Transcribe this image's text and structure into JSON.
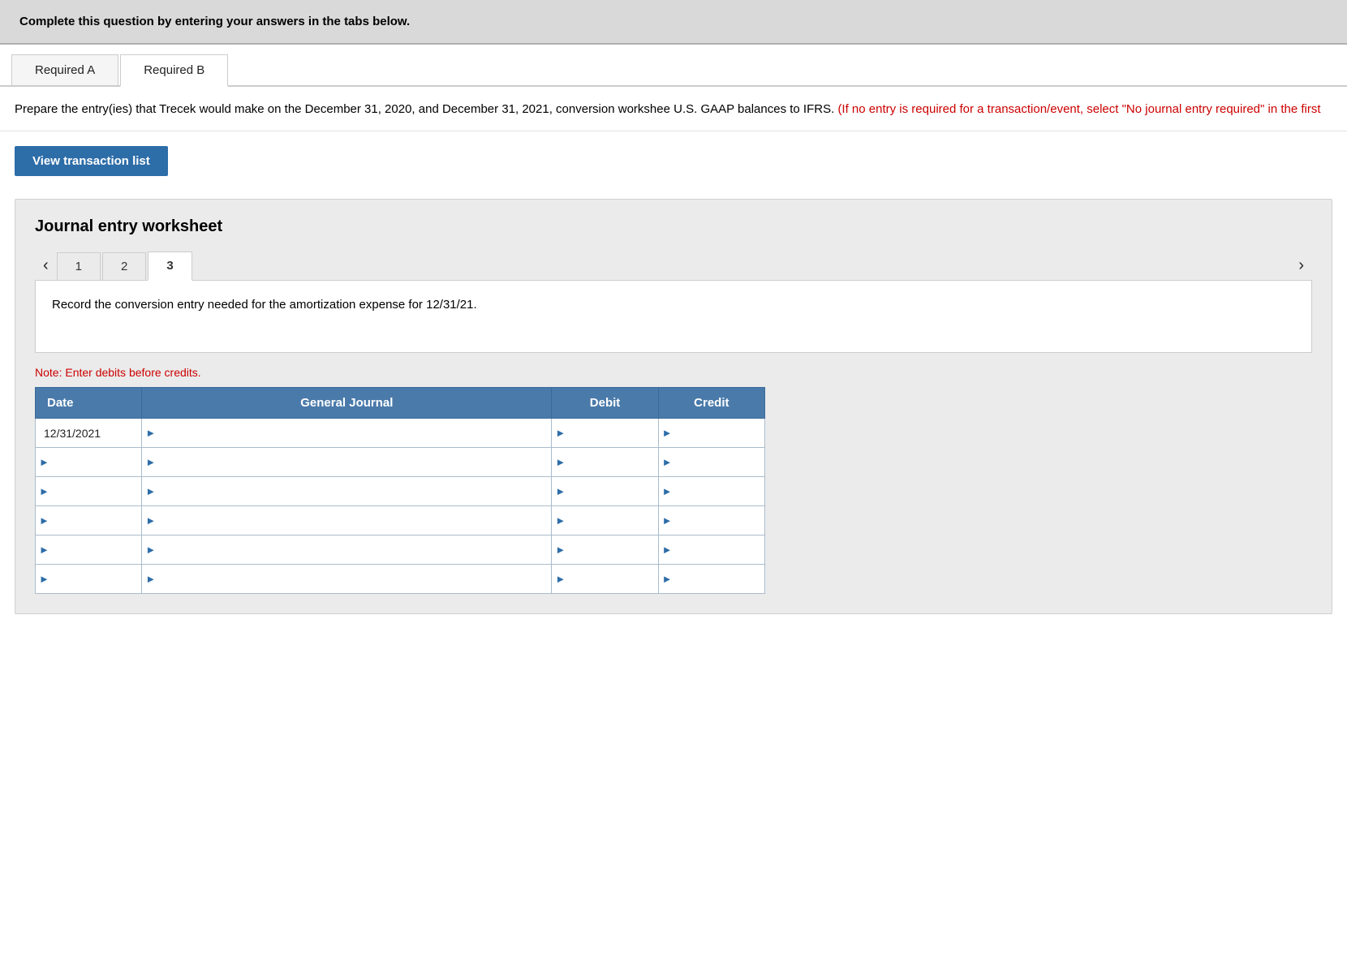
{
  "header": {
    "instruction": "Complete this question by entering your answers in the tabs below."
  },
  "tabs": [
    {
      "label": "Required A",
      "active": false
    },
    {
      "label": "Required B",
      "active": true
    }
  ],
  "instruction_text": {
    "main": "Prepare the entry(ies) that Trecek would make on the December 31, 2020, and December 31, 2021, conversion workshee U.S. GAAP balances to IFRS.",
    "red": "(If no entry is required for a transaction/event, select \"No journal entry required\" in the first"
  },
  "view_transaction_btn": "View transaction list",
  "worksheet": {
    "title": "Journal entry worksheet",
    "entry_tabs": [
      {
        "label": "1",
        "active": false
      },
      {
        "label": "2",
        "active": false
      },
      {
        "label": "3",
        "active": true
      }
    ],
    "description": "Record the conversion entry needed for the amortization expense for 12/31/21.",
    "note": "Note: Enter debits before credits.",
    "table": {
      "headers": [
        "Date",
        "General Journal",
        "Debit",
        "Credit"
      ],
      "rows": [
        {
          "date": "12/31/2021",
          "journal": "",
          "debit": "",
          "credit": ""
        },
        {
          "date": "",
          "journal": "",
          "debit": "",
          "credit": ""
        },
        {
          "date": "",
          "journal": "",
          "debit": "",
          "credit": ""
        },
        {
          "date": "",
          "journal": "",
          "debit": "",
          "credit": ""
        },
        {
          "date": "",
          "journal": "",
          "debit": "",
          "credit": ""
        },
        {
          "date": "",
          "journal": "",
          "debit": "",
          "credit": ""
        }
      ]
    }
  }
}
